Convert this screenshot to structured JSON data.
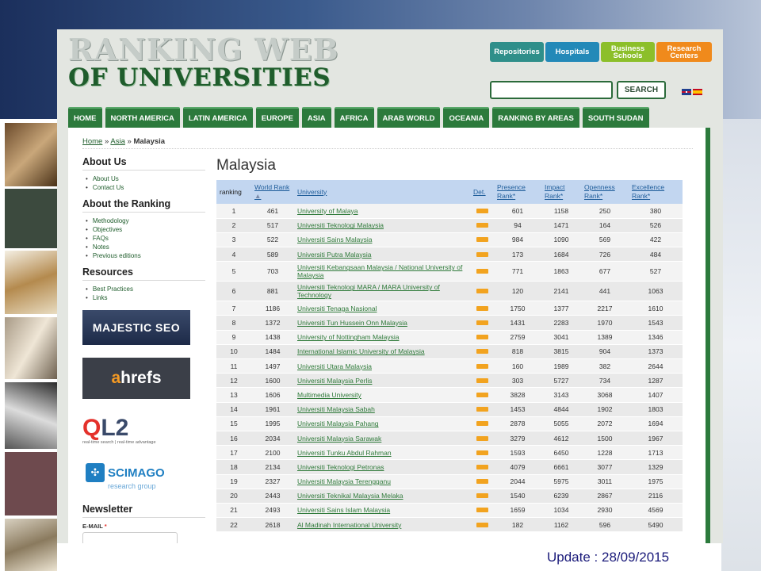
{
  "logo": {
    "line1": "RANKING WEB",
    "line2": "OF UNIVERSITIES"
  },
  "quick_links": [
    "Repositories",
    "Hospitals",
    "Business Schools",
    "Research Centers"
  ],
  "search": {
    "button_label": "SEARCH",
    "value": ""
  },
  "nav": [
    "HOME",
    "NORTH AMERICA",
    "LATIN AMERICA",
    "EUROPE",
    "ASIA",
    "AFRICA",
    "ARAB WORLD",
    "OCEANIA",
    "RANKING BY AREAS",
    "SOUTH SUDAN"
  ],
  "breadcrumb": {
    "home": "Home",
    "sep1": "»",
    "asia": "Asia",
    "sep2": "»",
    "current": "Malaysia"
  },
  "sidebar": {
    "about_us": {
      "title": "About Us",
      "items": [
        "About Us",
        "Contact Us"
      ]
    },
    "about_ranking": {
      "title": "About the Ranking",
      "items": [
        "Methodology",
        "Objectives",
        "FAQs",
        "Notes",
        "Previous editions"
      ]
    },
    "resources": {
      "title": "Resources",
      "items": [
        "Best Practices",
        "Links"
      ]
    },
    "sponsors": {
      "majestic": "MAJESTIC SEO",
      "ahrefs_a": "a",
      "ahrefs_rest": "hrefs",
      "ql2_q": "Q",
      "ql2_rest": "L2",
      "ql2_tag": "real-time search | real-time advantage",
      "scimago": "SCIMAGO",
      "scimago_sub": "research group"
    },
    "newsletter": {
      "title": "Newsletter",
      "email_label": "E-MAIL",
      "required_mark": "*"
    }
  },
  "page_title": "Malaysia",
  "table": {
    "headers": [
      "ranking",
      "World Rank",
      "University",
      "Det.",
      "Presence Rank*",
      "Impact Rank*",
      "Openness Rank*",
      "Excellence Rank*"
    ],
    "rows": [
      [
        "1",
        "461",
        "University of Malaya",
        "601",
        "1158",
        "250",
        "380"
      ],
      [
        "2",
        "517",
        "Universiti Teknologi Malaysia",
        "94",
        "1471",
        "164",
        "526"
      ],
      [
        "3",
        "522",
        "Universiti Sains Malaysia",
        "984",
        "1090",
        "569",
        "422"
      ],
      [
        "4",
        "589",
        "Universiti Putra Malaysia",
        "173",
        "1684",
        "726",
        "484"
      ],
      [
        "5",
        "703",
        "Universiti Kebangsaan Malaysia / National University of Malaysia",
        "771",
        "1863",
        "677",
        "527"
      ],
      [
        "6",
        "881",
        "Universiti Teknologi MARA / MARA University of Technology",
        "120",
        "2141",
        "441",
        "1063"
      ],
      [
        "7",
        "1186",
        "Universiti Tenaga Nasional",
        "1750",
        "1377",
        "2217",
        "1610"
      ],
      [
        "8",
        "1372",
        "Universiti Tun Hussein Onn Malaysia",
        "1431",
        "2283",
        "1970",
        "1543"
      ],
      [
        "9",
        "1438",
        "University of Nottingham Malaysia",
        "2759",
        "3041",
        "1389",
        "1346"
      ],
      [
        "10",
        "1484",
        "International Islamic University of Malaysia",
        "818",
        "3815",
        "904",
        "1373"
      ],
      [
        "11",
        "1497",
        "Universiti Utara Malaysia",
        "160",
        "1989",
        "382",
        "2644"
      ],
      [
        "12",
        "1600",
        "Universiti Malaysia Perlis",
        "303",
        "5727",
        "734",
        "1287"
      ],
      [
        "13",
        "1606",
        "Multimedia University",
        "3828",
        "3143",
        "3068",
        "1407"
      ],
      [
        "14",
        "1961",
        "Universiti Malaysia Sabah",
        "1453",
        "4844",
        "1902",
        "1803"
      ],
      [
        "15",
        "1995",
        "Universiti Malaysia Pahang",
        "2878",
        "5055",
        "2072",
        "1694"
      ],
      [
        "16",
        "2034",
        "Universiti Malaysia Sarawak",
        "3279",
        "4612",
        "1500",
        "1967"
      ],
      [
        "17",
        "2100",
        "Universiti Tunku Abdul Rahman",
        "1593",
        "6450",
        "1228",
        "1713"
      ],
      [
        "18",
        "2134",
        "Universiti Teknologi Petronas",
        "4079",
        "6661",
        "3077",
        "1329"
      ],
      [
        "19",
        "2327",
        "Universiti Malaysia Terengganu",
        "2044",
        "5975",
        "3011",
        "1975"
      ],
      [
        "20",
        "2443",
        "Universiti Teknikal Malaysia Melaka",
        "1540",
        "6239",
        "2867",
        "2116"
      ],
      [
        "21",
        "2493",
        "Universiti Sains Islam Malaysia",
        "1659",
        "1034",
        "2930",
        "4569"
      ],
      [
        "22",
        "2618",
        "Al Madinah International University",
        "182",
        "1162",
        "596",
        "5490"
      ]
    ]
  },
  "update_note": "Update : 28/09/2015"
}
